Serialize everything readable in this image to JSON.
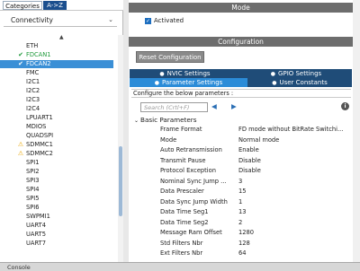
{
  "left_panel": {
    "tabs": {
      "categories": "Categories",
      "atoz": "A->Z"
    },
    "category_select": {
      "value": "Connectivity"
    },
    "peripherals": [
      {
        "label": "ETH",
        "status": "none"
      },
      {
        "label": "FDCAN1",
        "status": "ok"
      },
      {
        "label": "FDCAN2",
        "status": "ok",
        "selected": true
      },
      {
        "label": "FMC",
        "status": "none"
      },
      {
        "label": "I2C1",
        "status": "none"
      },
      {
        "label": "I2C2",
        "status": "none"
      },
      {
        "label": "I2C3",
        "status": "none"
      },
      {
        "label": "I2C4",
        "status": "none"
      },
      {
        "label": "LPUART1",
        "status": "none"
      },
      {
        "label": "MDIOS",
        "status": "none"
      },
      {
        "label": "QUADSPI",
        "status": "none"
      },
      {
        "label": "SDMMC1",
        "status": "warning"
      },
      {
        "label": "SDMMC2",
        "status": "warning"
      },
      {
        "label": "SPI1",
        "status": "none"
      },
      {
        "label": "SPI2",
        "status": "none"
      },
      {
        "label": "SPI3",
        "status": "none"
      },
      {
        "label": "SPI4",
        "status": "none"
      },
      {
        "label": "SPI5",
        "status": "none"
      },
      {
        "label": "SPI6",
        "status": "none"
      },
      {
        "label": "SWPMI1",
        "status": "none"
      },
      {
        "label": "UART4",
        "status": "none"
      },
      {
        "label": "UART5",
        "status": "none"
      },
      {
        "label": "UART7",
        "status": "none"
      }
    ]
  },
  "mode_section": {
    "title": "Mode",
    "activated_label": "Activated"
  },
  "configuration_section": {
    "title": "Configuration",
    "reset_button": "Reset Configuration",
    "tabs": {
      "nvic": "NVIC Settings",
      "gpio": "GPIO Settings",
      "parameter": "Parameter Settings",
      "user_constants": "User Constants"
    },
    "configure_text": "Configure the below parameters :",
    "search_placeholder": "Search (Crtl+F)",
    "group_title": "Basic Parameters",
    "parameters": [
      {
        "name": "Frame Format",
        "value": "FD mode without BitRate Switchi..."
      },
      {
        "name": "Mode",
        "value": "Normal mode"
      },
      {
        "name": "Auto Retransmission",
        "value": "Enable"
      },
      {
        "name": "Transmit Pause",
        "value": "Disable"
      },
      {
        "name": "Protocol Exception",
        "value": "Disable"
      },
      {
        "name": "Nominal Sync Jump ...",
        "value": "3"
      },
      {
        "name": "Data Prescaler",
        "value": "15"
      },
      {
        "name": "Data Sync Jump Width",
        "value": "1"
      },
      {
        "name": "Data Time Seg1",
        "value": "13"
      },
      {
        "name": "Data Time Seg2",
        "value": "2"
      },
      {
        "name": "Message Ram Offset",
        "value": "1280"
      },
      {
        "name": "Std Filters Nbr",
        "value": "128"
      },
      {
        "name": "Ext Filters Nbr",
        "value": "64"
      }
    ]
  },
  "console": {
    "label": "Console"
  },
  "colors": {
    "accent": "#3a8fd6",
    "ok": "#1f9a3b",
    "warning": "#e8a400",
    "header": "#6d6d6d"
  }
}
